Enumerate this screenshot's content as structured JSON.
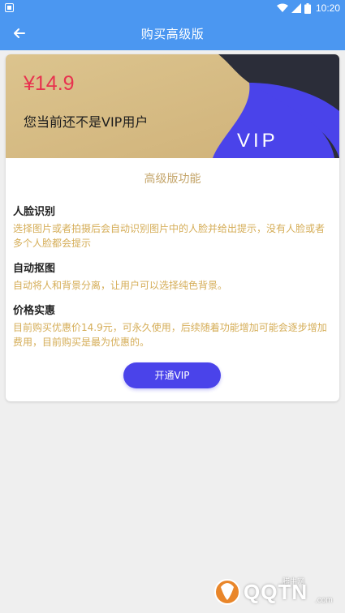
{
  "status_bar": {
    "time": "10:20"
  },
  "app_bar": {
    "title": "购买高级版"
  },
  "banner": {
    "price": "¥14.9",
    "status_message": "您当前还不是VIP用户",
    "badge_text": "VIP"
  },
  "features": {
    "heading": "高级版功能",
    "items": [
      {
        "title": "人脸识别",
        "description": "选择图片或者拍摄后会自动识别图片中的人脸并给出提示，没有人脸或者多个人脸都会提示"
      },
      {
        "title": "自动抠图",
        "description": "自动将人和背景分离，让用户可以选择纯色背景。"
      },
      {
        "title": "价格实惠",
        "description": "目前购买优惠价14.9元，可永久使用，后续随着功能增加可能会逐步增加费用，目前购买是最为优惠的。"
      }
    ]
  },
  "actions": {
    "open_vip_label": "开通VIP"
  },
  "watermark": {
    "brand": "QQTN",
    "site_name": "腾牛网",
    "domain": ".com"
  },
  "colors": {
    "primary": "#4b97f1",
    "price_red": "#e8324f",
    "gold_text": "#d5ad57",
    "button": "#4a43ea",
    "banner_gold": "#d9c08a",
    "banner_dark": "#2b2d39",
    "banner_blue": "#4a43ea"
  }
}
